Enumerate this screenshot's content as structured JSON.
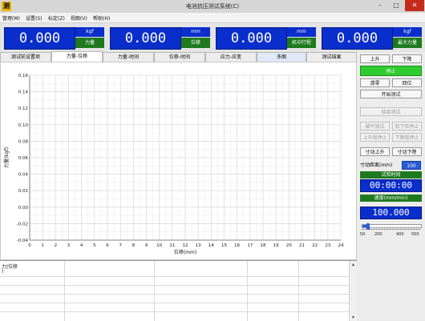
{
  "window": {
    "title": "电池抗压测试系统(C)",
    "icon_glyph": "测"
  },
  "menu": [
    "管理(M)",
    "设置(S)",
    "标定(Z)",
    "视图(V)",
    "帮助(H)"
  ],
  "readouts": [
    {
      "value": "0.000",
      "unit": "kgf",
      "name": "力量"
    },
    {
      "value": "0.000",
      "unit": "mm",
      "name": "位移"
    },
    {
      "value": "0.000",
      "unit": "mm",
      "name": "机中行程"
    },
    {
      "value": "0.000",
      "unit": "kgf",
      "name": "最大力量"
    }
  ],
  "tabs": [
    "测试前设置项",
    "力量-位移",
    "力量-时间",
    "位移-时间",
    "应力-应变",
    "多图",
    "测试结果"
  ],
  "active_tab": 1,
  "chart_data": {
    "type": "line",
    "xlabel": "位移(mm)",
    "ylabel": "力量(kgf)",
    "xlim": [
      0,
      24
    ],
    "ylim": [
      -0.04,
      0.16
    ],
    "x_ticks": [
      "0",
      "1",
      "2",
      "3",
      "4",
      "5",
      "6",
      "7",
      "8",
      "9",
      "10",
      "11",
      "12",
      "13",
      "14",
      "15",
      "16",
      "17",
      "18",
      "19",
      "20",
      "21",
      "22",
      "23",
      "24"
    ],
    "y_ticks": [
      "0.16",
      "0.14",
      "0.12",
      "0.10",
      "0.08",
      "0.06",
      "0.04",
      "0.02",
      "0.00",
      "-0.02",
      "-0.04"
    ],
    "grid": true,
    "series": []
  },
  "table": {
    "header": "力|位移",
    "subheader": ")"
  },
  "side": {
    "up": "上升",
    "down": "下降",
    "stop": "停止",
    "zero": "清零",
    "reset": "回位",
    "start_test": "开始测试",
    "end_test": "结束测试",
    "break_test": "破坏测试",
    "press_down_lift": "取下压停止",
    "up_travel_lift": "上升程停止",
    "down_travel_lift": "下降程停止",
    "jog_up": "寸动上升",
    "jog_down": "寸动下降",
    "jog_distance_label": "寸动距离(mm)",
    "jog_distance": "100",
    "test_time_label": "试验时间",
    "test_time": "00:00:00",
    "speed_label": "速度(mm/min)",
    "speed": "100.000",
    "speed_scale": [
      "50",
      "200",
      "400",
      "500"
    ],
    "speed_fraction": 0.1
  },
  "colors": {
    "readout_blue": "#0a2ecc",
    "label_green": "#1f7a1f",
    "stop_green": "#2fcc2f",
    "close_red": "#c42b1c"
  }
}
